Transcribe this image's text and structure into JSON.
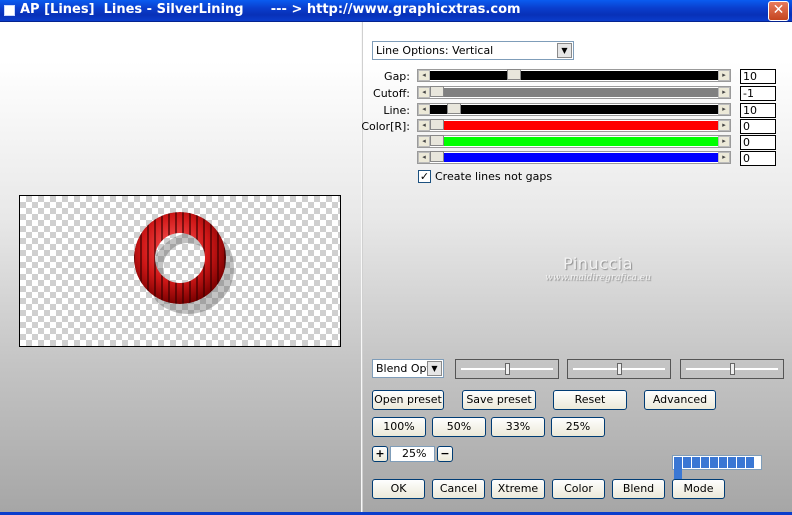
{
  "window": {
    "title": "AP [Lines]  Lines - SilverLining      --- > http://www.graphicxtras.com",
    "close_glyph": "✕"
  },
  "options": {
    "line_options_value": "Line Options: Vertical",
    "blend_value": "Blend Optio"
  },
  "sliders": [
    {
      "label": "Gap:",
      "value": "10",
      "fill": "#000000",
      "thumb": 0.28
    },
    {
      "label": "Cutoff:",
      "value": "-1",
      "fill": "#808080",
      "thumb": 0.0
    },
    {
      "label": "Line:",
      "value": "10",
      "fill": "#000000",
      "thumb": 0.06
    },
    {
      "label": "Color[R]:",
      "value": "0",
      "fill": "#ff0000",
      "thumb": 0.0
    },
    {
      "label": "",
      "value": "0",
      "fill": "#00ff00",
      "thumb": 0.0
    },
    {
      "label": "",
      "value": "0",
      "fill": "#0000ff",
      "thumb": 0.0
    }
  ],
  "checkbox": {
    "label": "Create lines not gaps",
    "checked": true,
    "mark": "✓"
  },
  "watermark": {
    "line1": "Pinuccia",
    "line2": "www.maidiregrafica.eu"
  },
  "color_swatches": [
    "#ff0000",
    "#00ff00",
    "#0000ff"
  ],
  "buttons": {
    "open_preset": "Open preset",
    "save_preset": "Save preset",
    "reset": "Reset",
    "advanced": "Advanced",
    "zoom100": "100%",
    "zoom50": "50%",
    "zoom33": "33%",
    "zoom25": "25%",
    "plus": "+",
    "minus": "−",
    "zoom_value": "25%",
    "ok": "OK",
    "cancel": "Cancel",
    "xtreme": "Xtreme",
    "color": "Color",
    "blend": "Blend",
    "mode": "Mode"
  },
  "progress": {
    "segments": 10
  }
}
